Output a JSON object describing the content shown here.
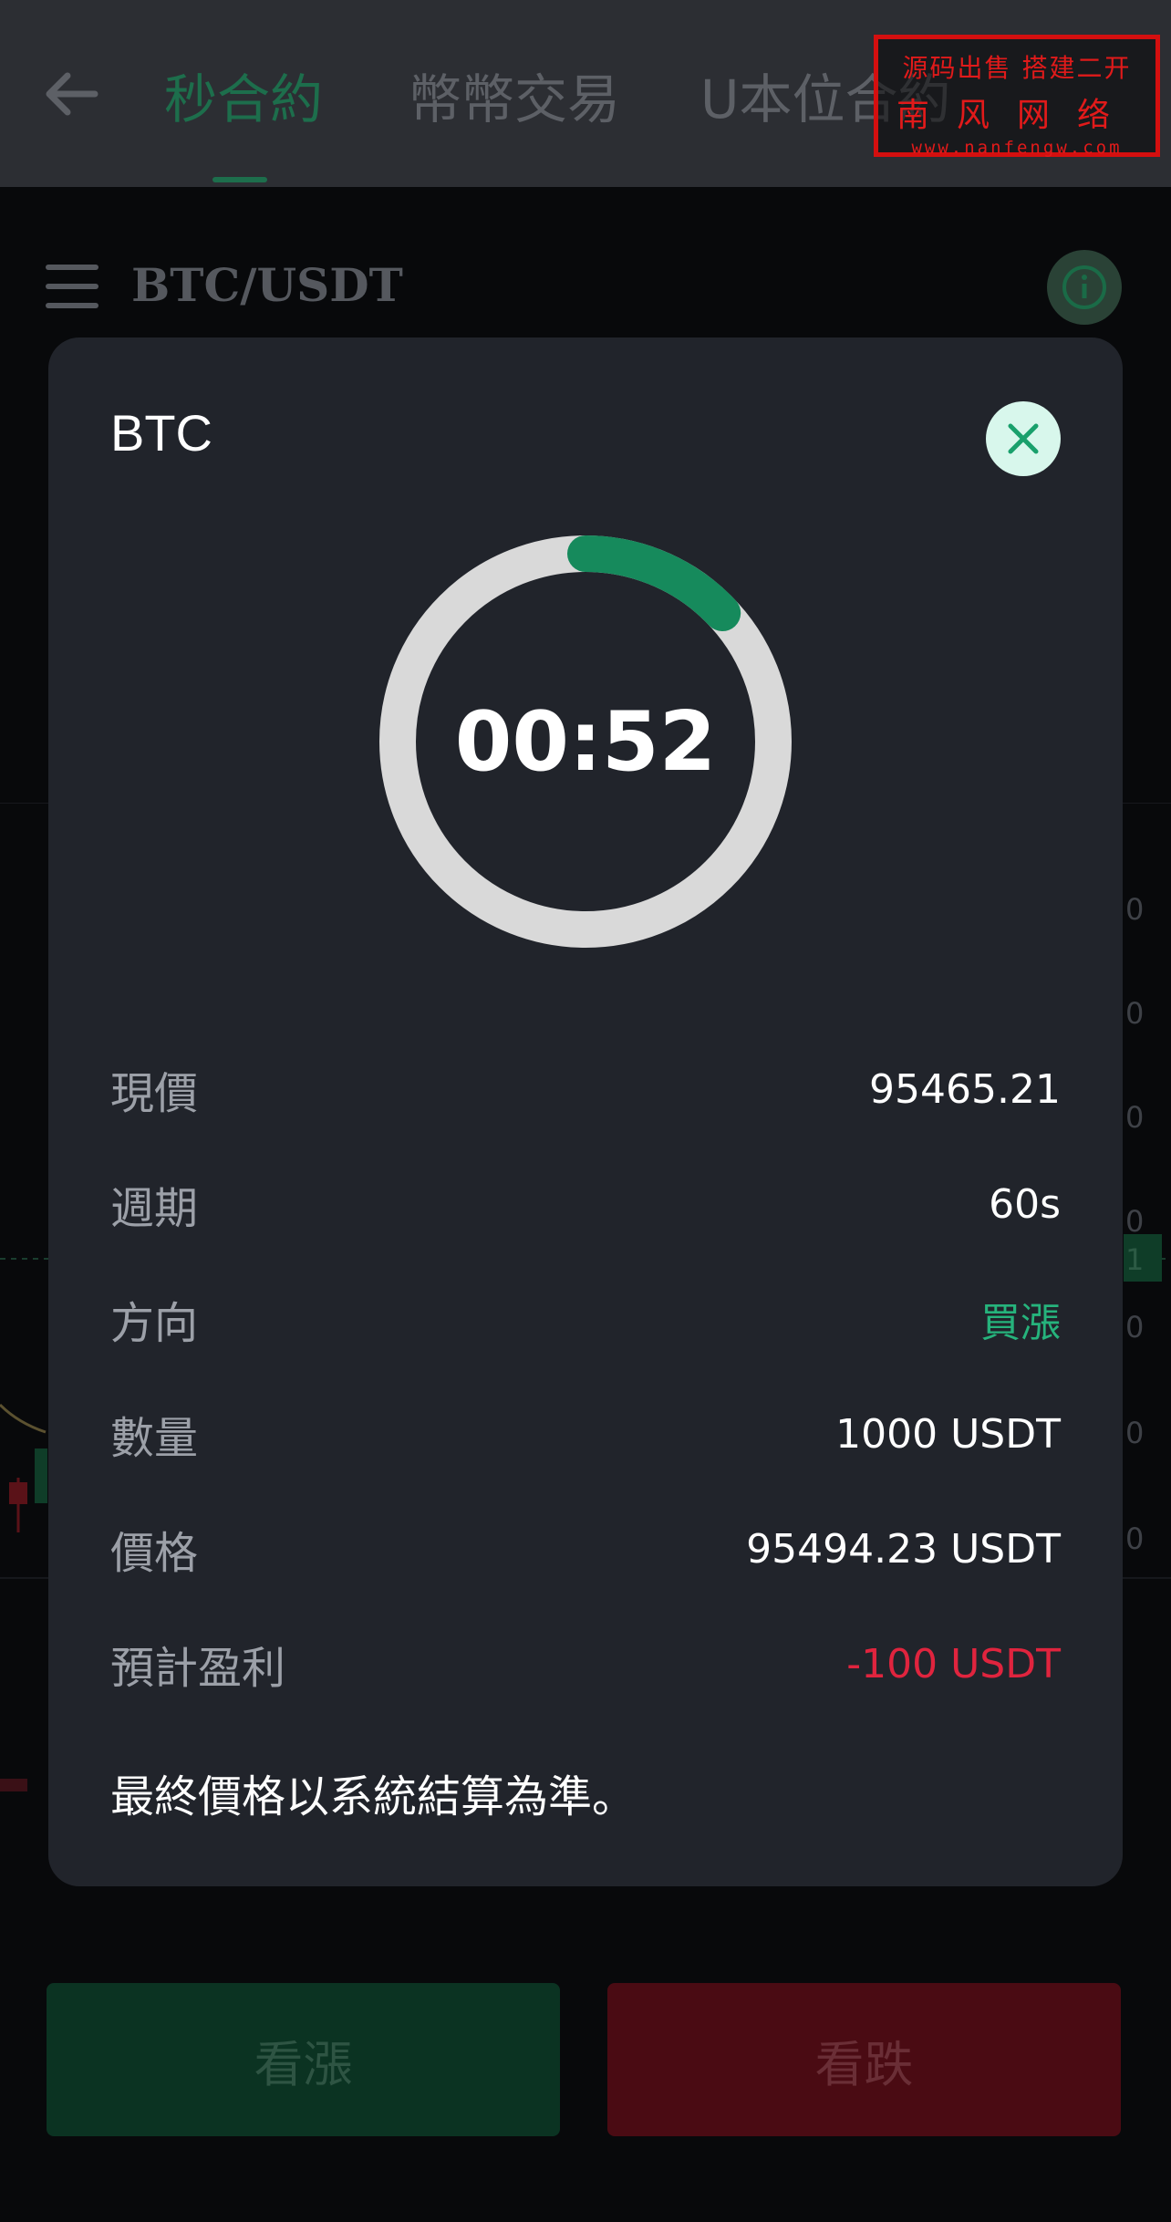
{
  "header": {
    "tabs": [
      {
        "label": "秒合約",
        "active": true
      },
      {
        "label": "幣幣交易",
        "active": false
      },
      {
        "label": "U本位合約",
        "active": false
      }
    ]
  },
  "watermark": {
    "line1": "源码出售 搭建二开",
    "line2": "南风网络",
    "line3": "www.nanfengw.com"
  },
  "pair": {
    "symbol": "BTC/USDT"
  },
  "bg_axis_labels": [
    "0",
    "0",
    "0",
    "0",
    "1",
    "0",
    "0",
    "0"
  ],
  "buttons": {
    "up_label": "看漲",
    "down_label": "看跌"
  },
  "modal": {
    "title": "BTC",
    "countdown": "00:52",
    "progress_fraction": 0.13,
    "rows": [
      {
        "label": "現價",
        "value": "95465.21",
        "tone": "default"
      },
      {
        "label": "週期",
        "value": "60s",
        "tone": "default"
      },
      {
        "label": "方向",
        "value": "買漲",
        "tone": "green"
      },
      {
        "label": "數量",
        "value": "1000 USDT",
        "tone": "default"
      },
      {
        "label": "價格",
        "value": "95494.23 USDT",
        "tone": "default"
      },
      {
        "label": "預計盈利",
        "value": "-100 USDT",
        "tone": "red"
      }
    ],
    "note": "最終價格以系統結算為準。"
  },
  "colors": {
    "accent_green": "#26b37c",
    "loss_red": "#e0243e",
    "progress_green": "#168a5c",
    "track_grey": "#d9d9d9"
  }
}
